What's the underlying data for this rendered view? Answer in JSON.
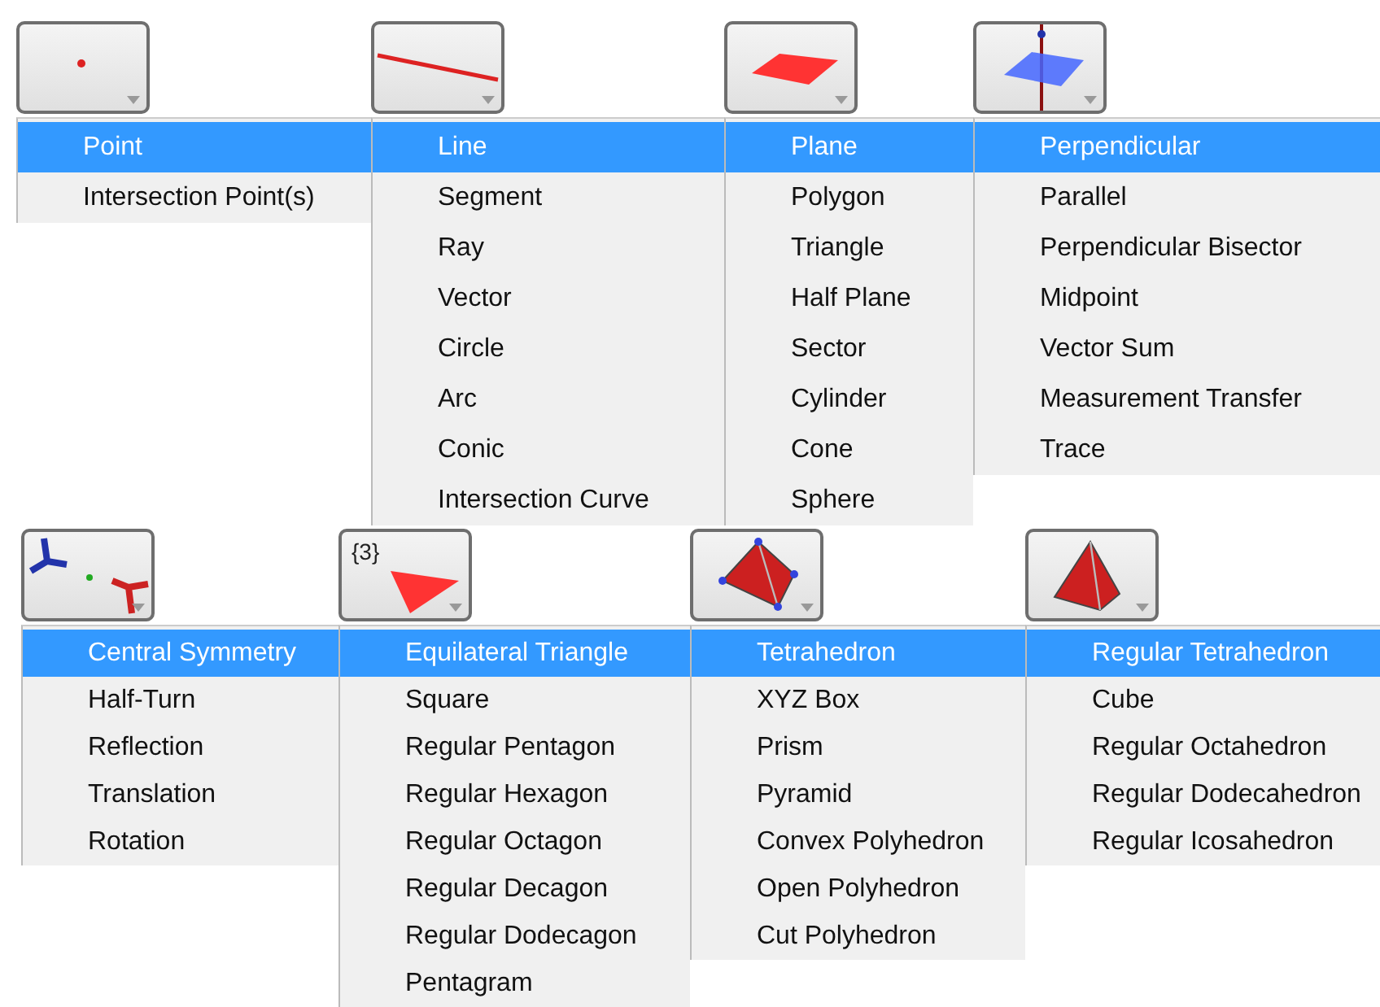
{
  "toolbar_rows": [
    {
      "tools": [
        {
          "menu": [
            {
              "label": "Point",
              "selected": true
            },
            {
              "label": "Intersection Point(s)",
              "selected": false
            }
          ]
        },
        {
          "menu": [
            {
              "label": "Line",
              "selected": true
            },
            {
              "label": "Segment",
              "selected": false
            },
            {
              "label": "Ray",
              "selected": false
            },
            {
              "label": "Vector",
              "selected": false
            },
            {
              "label": "Circle",
              "selected": false
            },
            {
              "label": "Arc",
              "selected": false
            },
            {
              "label": "Conic",
              "selected": false
            },
            {
              "label": "Intersection Curve",
              "selected": false
            }
          ]
        },
        {
          "menu": [
            {
              "label": "Plane",
              "selected": true
            },
            {
              "label": "Polygon",
              "selected": false
            },
            {
              "label": "Triangle",
              "selected": false
            },
            {
              "label": "Half Plane",
              "selected": false
            },
            {
              "label": "Sector",
              "selected": false
            },
            {
              "label": "Cylinder",
              "selected": false
            },
            {
              "label": "Cone",
              "selected": false
            },
            {
              "label": "Sphere",
              "selected": false
            }
          ]
        },
        {
          "menu": [
            {
              "label": "Perpendicular",
              "selected": true
            },
            {
              "label": "Parallel",
              "selected": false
            },
            {
              "label": "Perpendicular Bisector",
              "selected": false
            },
            {
              "label": "Midpoint",
              "selected": false
            },
            {
              "label": "Vector Sum",
              "selected": false
            },
            {
              "label": "Measurement Transfer",
              "selected": false
            },
            {
              "label": "Trace",
              "selected": false
            }
          ]
        }
      ]
    },
    {
      "tools": [
        {
          "menu": [
            {
              "label": "Central Symmetry",
              "selected": true
            },
            {
              "label": "Half-Turn",
              "selected": false
            },
            {
              "label": "Reflection",
              "selected": false
            },
            {
              "label": "Translation",
              "selected": false
            },
            {
              "label": "Rotation",
              "selected": false
            }
          ]
        },
        {
          "icon_text": "{3}",
          "menu": [
            {
              "label": "Equilateral Triangle",
              "selected": true
            },
            {
              "label": "Square",
              "selected": false
            },
            {
              "label": "Regular Pentagon",
              "selected": false
            },
            {
              "label": "Regular Hexagon",
              "selected": false
            },
            {
              "label": "Regular Octagon",
              "selected": false
            },
            {
              "label": "Regular Decagon",
              "selected": false
            },
            {
              "label": "Regular Dodecagon",
              "selected": false
            },
            {
              "label": "Pentagram",
              "selected": false
            }
          ]
        },
        {
          "menu": [
            {
              "label": "Tetrahedron",
              "selected": true
            },
            {
              "label": "XYZ Box",
              "selected": false
            },
            {
              "label": "Prism",
              "selected": false
            },
            {
              "label": "Pyramid",
              "selected": false
            },
            {
              "label": "Convex Polyhedron",
              "selected": false
            },
            {
              "label": "Open Polyhedron",
              "selected": false
            },
            {
              "label": "Cut Polyhedron",
              "selected": false
            }
          ]
        },
        {
          "menu": [
            {
              "label": "Regular Tetrahedron",
              "selected": true
            },
            {
              "label": "Cube",
              "selected": false
            },
            {
              "label": "Regular Octahedron",
              "selected": false
            },
            {
              "label": "Regular Dodecahedron",
              "selected": false
            },
            {
              "label": "Regular Icosahedron",
              "selected": false
            }
          ]
        }
      ]
    }
  ]
}
